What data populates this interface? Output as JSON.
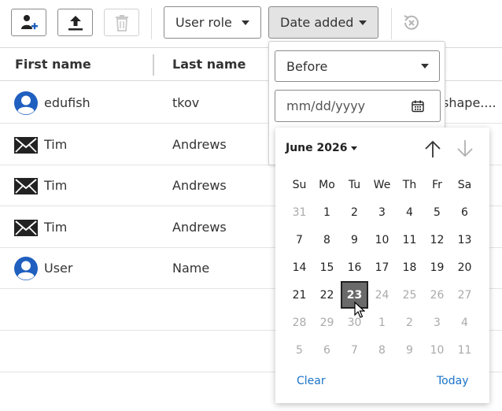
{
  "toolbar": {
    "add_user_button": "add-user-icon",
    "upload_button": "upload-icon",
    "delete_button": "trash-icon",
    "user_role_filter": "User role",
    "date_added_filter": "Date added",
    "reset_icon": "reset-filter-icon"
  },
  "table": {
    "headers": [
      "First name",
      "Last name"
    ],
    "rows": [
      {
        "icon": "user-avatar-icon",
        "first": "edufish",
        "last": "tkov",
        "extra": "shape...."
      },
      {
        "icon": "envelope-icon",
        "first": "Tim",
        "last": "Andrews",
        "extra": ""
      },
      {
        "icon": "envelope-icon",
        "first": "Tim",
        "last": "Andrews",
        "extra": ""
      },
      {
        "icon": "envelope-icon",
        "first": "Tim",
        "last": "Andrews",
        "extra": ""
      },
      {
        "icon": "user-avatar-icon",
        "first": "User",
        "last": "Name",
        "extra": ""
      }
    ]
  },
  "date_filter": {
    "condition": "Before",
    "date_placeholder": "mm/dd/yyyy"
  },
  "calendar": {
    "month_label": "June 2026",
    "weekdays": [
      "Su",
      "Mo",
      "Tu",
      "We",
      "Th",
      "Fr",
      "Sa"
    ],
    "weeks": [
      [
        {
          "d": "31",
          "out": true
        },
        {
          "d": "1"
        },
        {
          "d": "2"
        },
        {
          "d": "3"
        },
        {
          "d": "4"
        },
        {
          "d": "5"
        },
        {
          "d": "6"
        }
      ],
      [
        {
          "d": "7"
        },
        {
          "d": "8"
        },
        {
          "d": "9"
        },
        {
          "d": "10"
        },
        {
          "d": "11"
        },
        {
          "d": "12"
        },
        {
          "d": "13"
        }
      ],
      [
        {
          "d": "14"
        },
        {
          "d": "15"
        },
        {
          "d": "16"
        },
        {
          "d": "17"
        },
        {
          "d": "18"
        },
        {
          "d": "19"
        },
        {
          "d": "20"
        }
      ],
      [
        {
          "d": "21"
        },
        {
          "d": "22"
        },
        {
          "d": "23",
          "selected": true
        },
        {
          "d": "24",
          "out": true
        },
        {
          "d": "25",
          "out": true
        },
        {
          "d": "26",
          "out": true
        },
        {
          "d": "27",
          "out": true
        }
      ],
      [
        {
          "d": "28",
          "out": true
        },
        {
          "d": "29",
          "out": true
        },
        {
          "d": "30",
          "out": true
        },
        {
          "d": "1",
          "out": true
        },
        {
          "d": "2",
          "out": true
        },
        {
          "d": "3",
          "out": true
        },
        {
          "d": "4",
          "out": true
        }
      ],
      [
        {
          "d": "5",
          "out": true
        },
        {
          "d": "6",
          "out": true
        },
        {
          "d": "7",
          "out": true
        },
        {
          "d": "8",
          "out": true
        },
        {
          "d": "9",
          "out": true
        },
        {
          "d": "10",
          "out": true
        },
        {
          "d": "11",
          "out": true
        }
      ]
    ],
    "clear_label": "Clear",
    "today_label": "Today"
  },
  "colors": {
    "accent_link": "#1a73c8",
    "avatar_blue": "#1f5fbf",
    "selected_day_bg": "#6a6a6a"
  }
}
